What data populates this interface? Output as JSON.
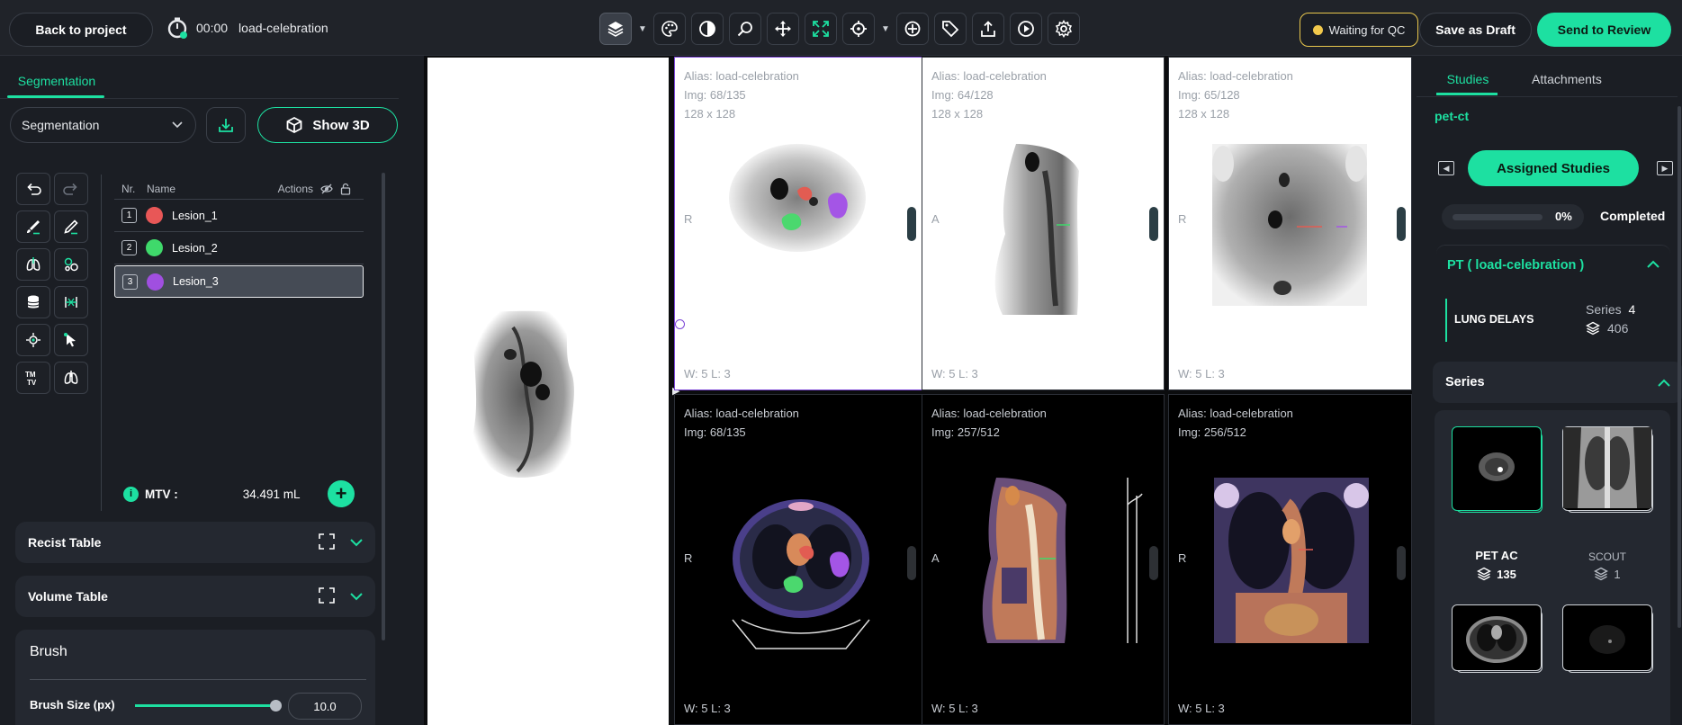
{
  "header": {
    "back_label": "Back to project",
    "timer": "00:00",
    "project_name": "load-celebration",
    "status_label": "Waiting for QC",
    "save_draft_label": "Save as Draft",
    "send_review_label": "Send to Review",
    "accent_color": "#1de0a1",
    "status_color": "#f2c94c",
    "tools": [
      "layers-icon",
      "palette-icon",
      "contrast-icon",
      "zoom-icon",
      "pan-icon",
      "fit-icon",
      "crosshair-icon",
      "target-icon",
      "tag-icon",
      "upload-icon",
      "play-icon",
      "settings-icon"
    ]
  },
  "left_panel": {
    "tab_label": "Segmentation",
    "select_value": "Segmentation",
    "show3d_label": "Show 3D",
    "table_headers": {
      "nr": "Nr.",
      "name": "Name",
      "actions": "Actions"
    },
    "lesions": [
      {
        "nr": "1",
        "name": "Lesion_1",
        "color": "#e85757"
      },
      {
        "nr": "2",
        "name": "Lesion_2",
        "color": "#3fd96b"
      },
      {
        "nr": "3",
        "name": "Lesion_3",
        "color": "#a04fe0"
      }
    ],
    "mtv_label": "MTV :",
    "mtv_value": "34.491 mL",
    "recist_label": "Recist Table",
    "volume_label": "Volume Table",
    "brush_title": "Brush",
    "brush_size_label": "Brush Size (px)",
    "brush_size_value": "10.0",
    "brush_level_fraction": 0.97
  },
  "viewports": {
    "top": [
      {
        "alias": "Alias: load-celebration",
        "img": "Img: 68/135",
        "dims": "128 x 128",
        "orient": "R",
        "wl": "W:  5  L:  3"
      },
      {
        "alias": "Alias: load-celebration",
        "img": "Img: 64/128",
        "dims": "128 x 128",
        "orient": "A",
        "wl": "W:  5  L:  3"
      },
      {
        "alias": "Alias: load-celebration",
        "img": "Img: 65/128",
        "dims": "128 x 128",
        "orient": "R",
        "wl": "W:  5  L:  3"
      }
    ],
    "bottom": [
      {
        "alias": "Alias: load-celebration",
        "img": "Img: 68/135",
        "orient": "R",
        "wl": "W:  5  L:  3"
      },
      {
        "alias": "Alias: load-celebration",
        "img": "Img: 257/512",
        "orient": "A",
        "wl": "W:  5  L:  3"
      },
      {
        "alias": "Alias: load-celebration",
        "img": "Img: 256/512",
        "orient": "R",
        "wl": "W:  5  L:  3"
      }
    ]
  },
  "right_panel": {
    "tab_studies": "Studies",
    "tab_attachments": "Attachments",
    "project": "pet-ct",
    "assigned_label": "Assigned Studies",
    "progress_pct": "0%",
    "progress_fraction": 0,
    "completed_label": "Completed",
    "study_title": "PT ( load-celebration )",
    "study_name": "LUNG DELAYS",
    "series_label": "Series",
    "series_count": "4",
    "image_count": "406",
    "series_section": "Series",
    "series": [
      {
        "name": "PET AC",
        "count": "135"
      },
      {
        "name": "SCOUT",
        "count": "1"
      }
    ]
  }
}
